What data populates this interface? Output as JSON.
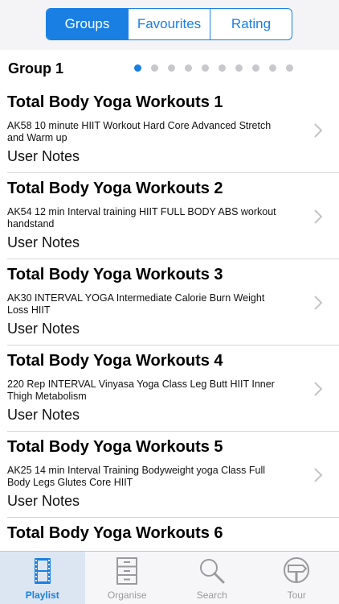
{
  "segments": [
    {
      "label": "Groups",
      "active": true
    },
    {
      "label": "Favourites",
      "active": false
    },
    {
      "label": "Rating",
      "active": false
    }
  ],
  "group": {
    "title": "Group 1",
    "page_count": 10,
    "current_page": 1
  },
  "workouts": [
    {
      "title": "Total Body Yoga Workouts 1",
      "description": "AK58 10 minute HIIT Workout Hard Core Advanced Stretch and Warm up",
      "notes": "User Notes"
    },
    {
      "title": "Total Body Yoga Workouts 2",
      "description": "AK54 12 min Interval training HIIT FULL BODY ABS workout handstand",
      "notes": "User Notes"
    },
    {
      "title": "Total Body Yoga Workouts 3",
      "description": "AK30 INTERVAL YOGA Intermediate Calorie Burn Weight Loss HIIT",
      "notes": "User Notes"
    },
    {
      "title": "Total Body Yoga Workouts 4",
      "description": "220 Rep INTERVAL Vinyasa Yoga Class Leg Butt HIIT Inner Thigh Metabolism",
      "notes": "User Notes"
    },
    {
      "title": "Total Body Yoga Workouts 5",
      "description": "AK25 14 min Interval Training Bodyweight yoga Class Full Body Legs Glutes Core HIIT",
      "notes": "User Notes"
    },
    {
      "title": "Total Body Yoga Workouts 6",
      "description": "",
      "notes": ""
    }
  ],
  "tabs": [
    {
      "label": "Playlist",
      "icon": "film-strip-icon",
      "active": true
    },
    {
      "label": "Organise",
      "icon": "cabinet-icon",
      "active": false
    },
    {
      "label": "Search",
      "icon": "magnifier-icon",
      "active": false
    },
    {
      "label": "Tour",
      "icon": "signpost-icon",
      "active": false
    }
  ],
  "colors": {
    "accent": "#1a7fe3",
    "inactive": "#9a9a9e"
  }
}
